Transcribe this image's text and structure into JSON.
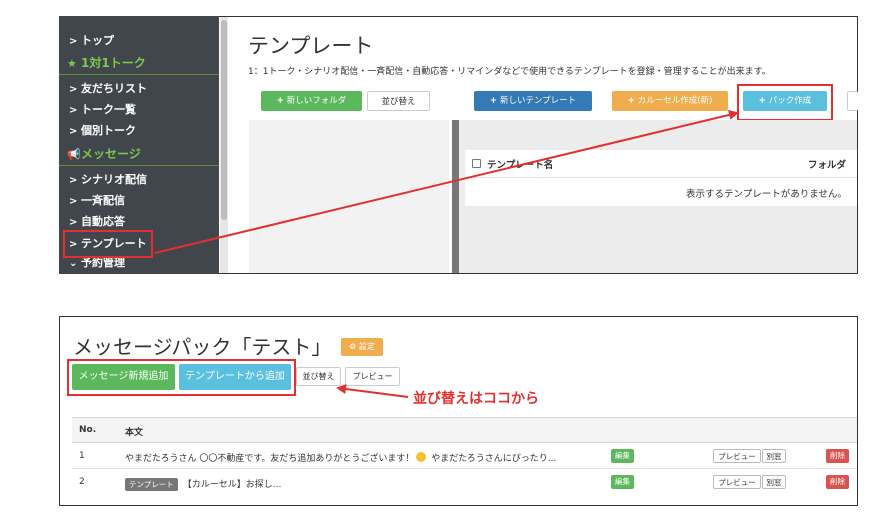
{
  "colors": {
    "sidebar_bg": "#41464d",
    "sidebar_section": "#7ec84e",
    "highlight_red": "#e3302f",
    "btn_green": "#5cb85c",
    "btn_blue": "#337ab7",
    "btn_orange": "#f0ad4e",
    "btn_cyan": "#5bc0de",
    "btn_danger": "#d9534f",
    "settings_orange": "#f0ad4e"
  },
  "sidebar": {
    "items": [
      {
        "label": "トップ",
        "icon": "chevron-right-icon"
      },
      {
        "label": "1対1トーク",
        "icon": "star-icon",
        "section": true
      },
      {
        "label": "友だちリスト",
        "icon": "chevron-right-icon"
      },
      {
        "label": "トーク一覧",
        "icon": "chevron-right-icon"
      },
      {
        "label": "個別トーク",
        "icon": "chevron-right-icon"
      },
      {
        "label": "メッセージ",
        "icon": "megaphone-icon",
        "section": true
      },
      {
        "label": "シナリオ配信",
        "icon": "chevron-right-icon"
      },
      {
        "label": "一斉配信",
        "icon": "chevron-right-icon"
      },
      {
        "label": "自動応答",
        "icon": "chevron-right-icon"
      },
      {
        "label": "テンプレート",
        "icon": "chevron-right-icon"
      },
      {
        "label": "予約管理",
        "icon": "chevron-down-icon"
      }
    ]
  },
  "template_page": {
    "title": "テンプレート",
    "description": "1：1トーク・シナリオ配信・一斉配信・自動応答・リマインダなどで使用できるテンプレートを登録・管理することが出来ます。",
    "buttons": {
      "new_folder": "新しいフォルダ",
      "sort": "並び替え",
      "new_template": "新しいテンプレート",
      "carousel_new": "カルーセル作成(新)",
      "pack_create": "パック作成"
    },
    "list": {
      "col_name": "テンプレート名",
      "col_folder": "フォルダ",
      "empty": "表示するテンプレートがありません。"
    }
  },
  "message_pack": {
    "title": "メッセージパック「テスト」",
    "settings_label": "設定",
    "buttons": {
      "add_new": "メッセージ新規追加",
      "add_from_template": "テンプレートから追加",
      "sort": "並び替え",
      "preview": "プレビュー"
    },
    "annotation": "並び替えはココから",
    "table": {
      "headers": [
        "No.",
        "本文"
      ],
      "rows": [
        {
          "no": "1",
          "text_before": "やまだたろうさん 〇〇不動産です。友だち追加ありがとうございます！",
          "text_after": " やまだたろうさんにぴったり...",
          "edit": "編集",
          "preview": "プレビュー",
          "window": "別窓",
          "delete": "削除"
        },
        {
          "no": "2",
          "tag": "テンプレート",
          "text_after": "【カルーセル】お探し...",
          "edit": "編集",
          "preview": "プレビュー",
          "window": "別窓",
          "delete": "削除"
        }
      ]
    }
  }
}
